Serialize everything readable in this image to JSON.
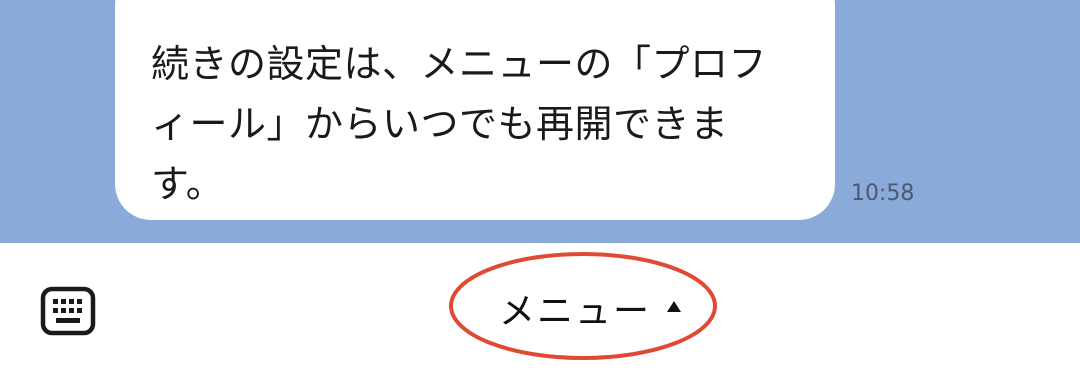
{
  "chat": {
    "message": {
      "lines": [
        "続きの設定は、メニューの「プロフ",
        "ィール」からいつでも再開できま",
        "す。"
      ],
      "time": "10:58"
    }
  },
  "bottom_bar": {
    "keyboard_icon": "keyboard-icon",
    "menu_label": "メニュー",
    "menu_caret_icon": "caret-up-icon",
    "highlight_color": "#e04a35"
  },
  "colors": {
    "chat_background": "#8aaad9",
    "bubble": "#ffffff"
  }
}
